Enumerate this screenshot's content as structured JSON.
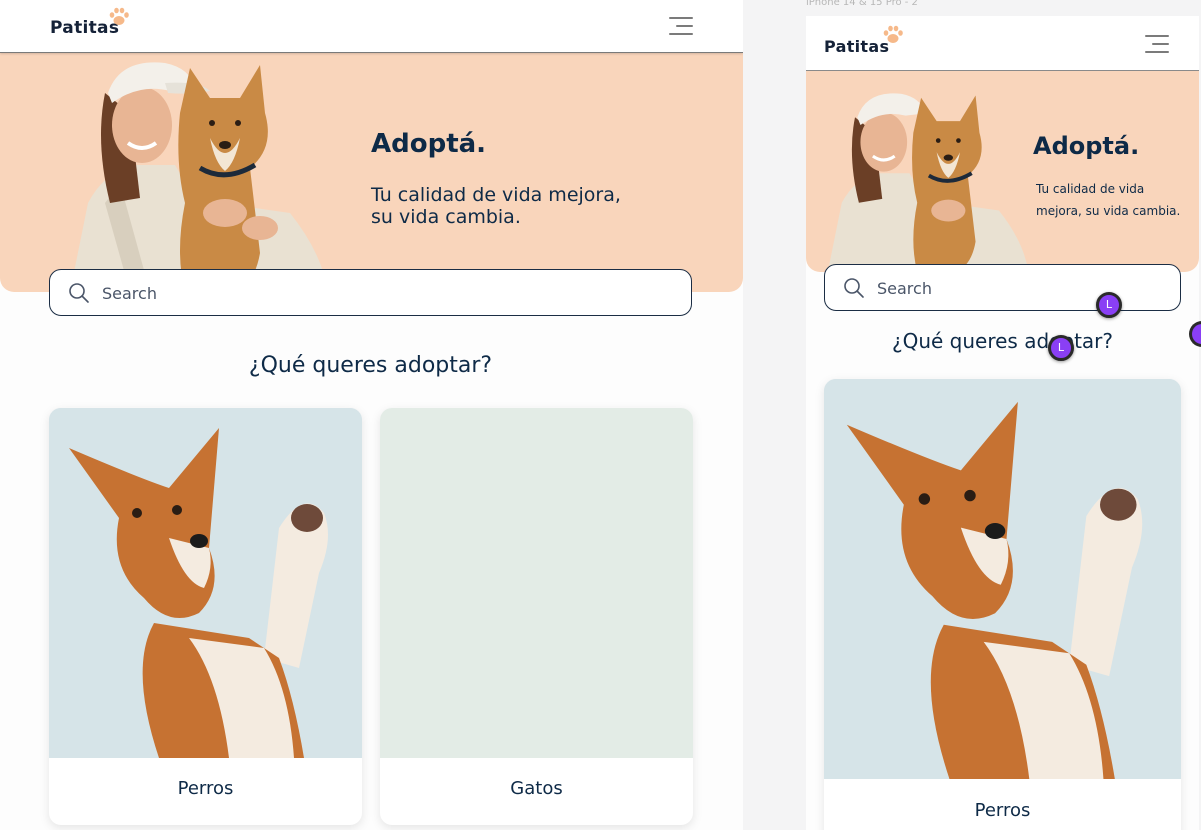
{
  "brand": {
    "logo_text": "Patitas",
    "paw_color": "#f6b98a",
    "hero_color": "#f9d5bb",
    "text_color": "#0e2a47"
  },
  "hero": {
    "title": "Adoptá.",
    "subtitle_line1": "Tu calidad de vida mejora,",
    "subtitle_line2": "su vida cambia.",
    "mobile_sub_line1": "Tu calidad de vida",
    "mobile_sub_line2": "mejora, su vida cambia."
  },
  "search": {
    "placeholder": "Search",
    "icon": "search-icon"
  },
  "section": {
    "title": "¿Qué queres adoptar?"
  },
  "categories": [
    {
      "label": "Perros",
      "bg": "#d6e4e8"
    },
    {
      "label": "Gatos",
      "bg": "#e3ece6"
    }
  ],
  "mobile_frame_label": "iPhone 14 & 15 Pro - 2",
  "cursors": [
    {
      "initial": "L",
      "color": "#8a3ff5"
    },
    {
      "initial": "L",
      "color": "#8a3ff5"
    }
  ]
}
